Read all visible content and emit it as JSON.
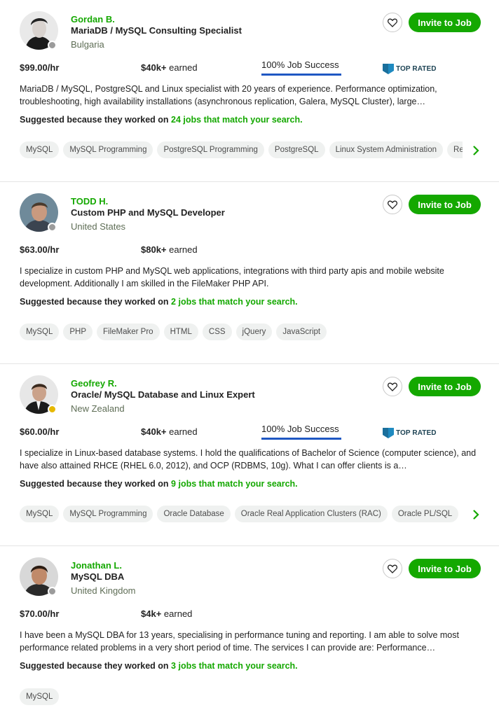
{
  "colors": {
    "accent_green": "#14a800",
    "online_dot_gray": "#9b9b9b",
    "online_dot_yellow": "#e6b800",
    "jss_bar_blue": "#1f57c3",
    "top_rated_blue": "#1f8ac0"
  },
  "labels": {
    "invite": "Invite to Job",
    "suggested_prefix": "Suggested because they worked on",
    "job_success": "100% Job Success",
    "top_rated": "TOP RATED"
  },
  "freelancers": [
    {
      "name": "Gordan B.",
      "title": "MariaDB / MySQL Consulting Specialist",
      "country": "Bulgaria",
      "rate": "$99.00/hr",
      "earned": "$40k+",
      "earned_suffix": "earned",
      "job_success": "100% Job Success",
      "top_rated": "TOP RATED",
      "description": "MariaDB / MySQL, PostgreSQL and Linux specialist with 20 years of experience. Performance optimization, troubleshooting, high availability installations (asynchronous replication, Galera, MySQL Cluster), large…",
      "suggested_link": "24 jobs that match your search.",
      "skills": [
        "MySQL",
        "MySQL Programming",
        "PostgreSQL Programming",
        "PostgreSQL",
        "Linux System Administration",
        "Re"
      ]
    },
    {
      "name": "TODD H.",
      "title": "Custom PHP and MySQL Developer",
      "country": "United States",
      "rate": "$63.00/hr",
      "earned": "$80k+",
      "earned_suffix": "earned",
      "description": "I specialize in custom PHP and MySQL web applications, integrations with third party apis and mobile website development. Additionally I am skilled in the FileMaker PHP API.",
      "suggested_link": "2 jobs that match your search.",
      "skills": [
        "MySQL",
        "PHP",
        "FileMaker Pro",
        "HTML",
        "CSS",
        "jQuery",
        "JavaScript"
      ]
    },
    {
      "name": "Geofrey R.",
      "title": "Oracle/ MySQL Database and Linux Expert",
      "country": "New Zealand",
      "rate": "$60.00/hr",
      "earned": "$40k+",
      "earned_suffix": "earned",
      "job_success": "100% Job Success",
      "top_rated": "TOP RATED",
      "description": "I specialize in Linux-based database systems. I hold the qualifications of Bachelor of Science (computer science), and have also attained RHCE (RHEL 6.0, 2012), and OCP (RDBMS, 10g). What I can offer clients is a…",
      "suggested_link": "9 jobs that match your search.",
      "skills": [
        "MySQL",
        "MySQL Programming",
        "Oracle Database",
        "Oracle Real Application Clusters (RAC)",
        "Oracle PL/SQL",
        ""
      ]
    },
    {
      "name": "Jonathan L.",
      "title": "MySQL DBA",
      "country": "United Kingdom",
      "rate": "$70.00/hr",
      "earned": "$4k+",
      "earned_suffix": "earned",
      "description": "I have been a MySQL DBA for 13 years, specialising in performance tuning and reporting. I am able to solve most performance related problems in a very short period of time. The services I can provide are: Performance…",
      "suggested_link": "3 jobs that match your search.",
      "skills": [
        "MySQL"
      ]
    }
  ]
}
